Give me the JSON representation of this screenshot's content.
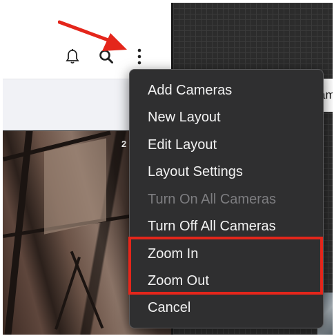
{
  "header": {
    "icons": [
      "bell-icon",
      "search-icon",
      "more-vertical-icon"
    ]
  },
  "overlay": {
    "right_panel_text": "am",
    "feed_label": "2"
  },
  "menu": {
    "items": [
      {
        "label": "Add Cameras",
        "enabled": true
      },
      {
        "label": "New Layout",
        "enabled": true
      },
      {
        "label": "Edit Layout",
        "enabled": true
      },
      {
        "label": "Layout Settings",
        "enabled": true
      },
      {
        "label": "Turn On All Cameras",
        "enabled": false
      },
      {
        "label": "Turn Off All Cameras",
        "enabled": true
      },
      {
        "label": "Zoom In",
        "enabled": true
      },
      {
        "label": "Zoom Out",
        "enabled": true
      },
      {
        "label": "Cancel",
        "enabled": true
      }
    ]
  },
  "annotations": {
    "arrow_color": "#e4261b",
    "highlight_color": "#e4261b",
    "highlighted_items": [
      "Zoom In",
      "Zoom Out"
    ]
  },
  "colors": {
    "menu_bg": "#2f2f30",
    "menu_text": "#f2f2f2",
    "menu_text_disabled": "#7d7d80"
  }
}
